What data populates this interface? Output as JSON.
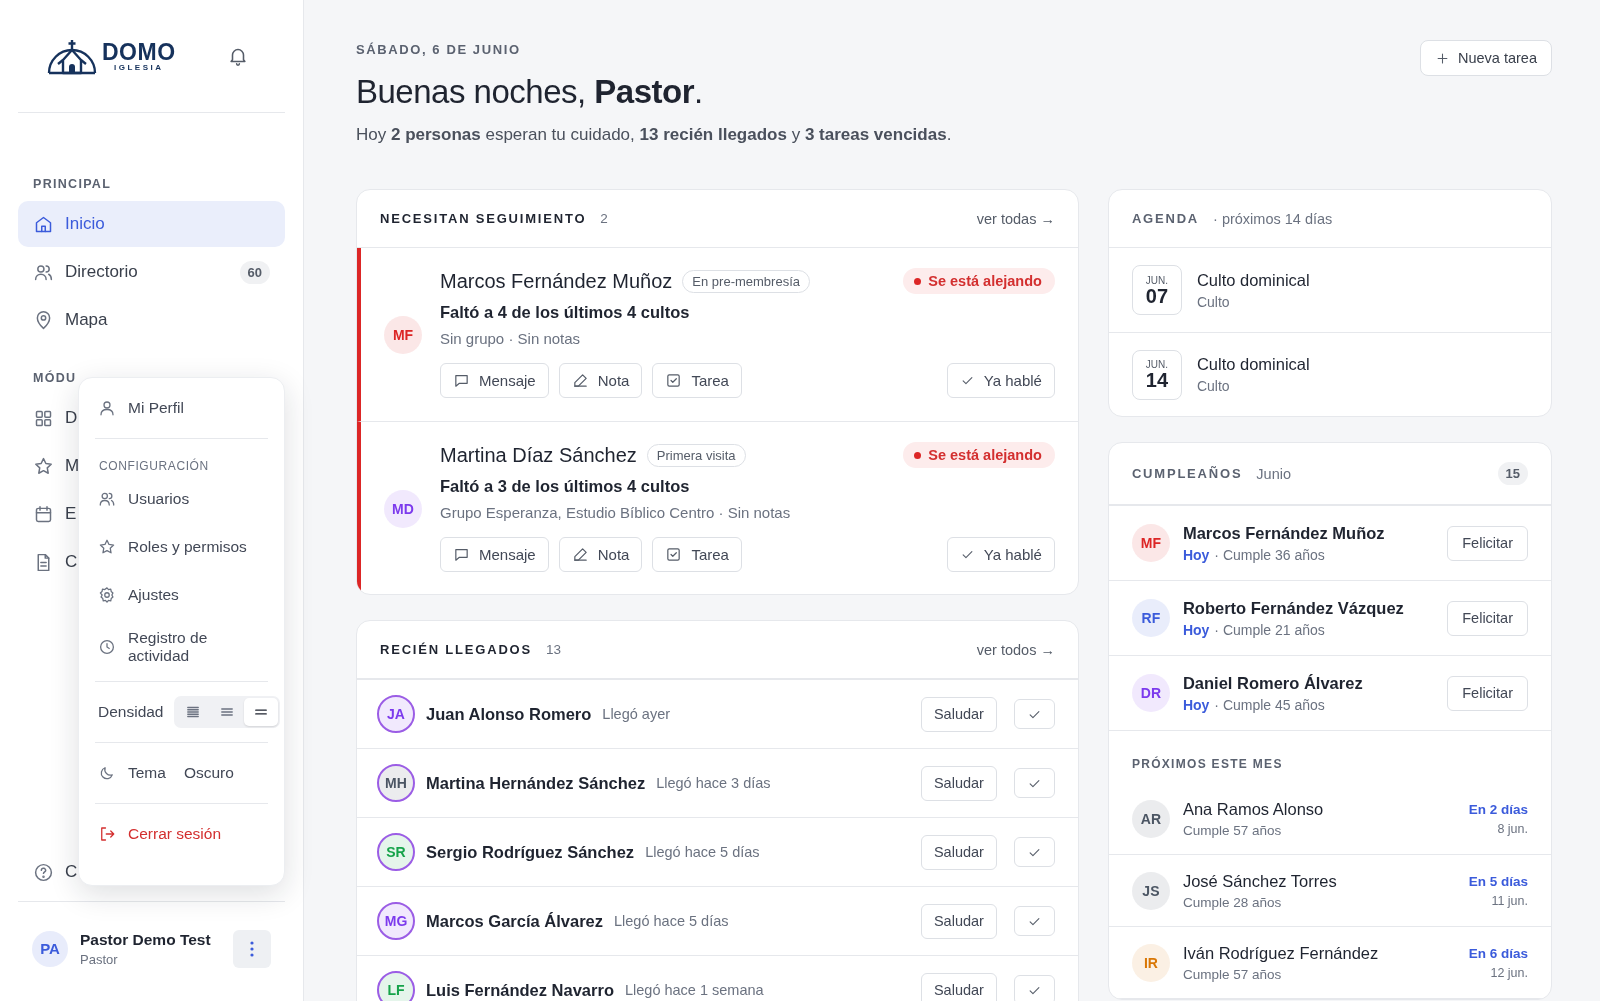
{
  "sidebar": {
    "logo": {
      "name": "DOMO",
      "subtitle": "IGLESIA"
    },
    "sections": [
      {
        "title": "PRINCIPAL",
        "items": [
          {
            "label": "Inicio",
            "selected": true
          },
          {
            "label": "Directorio",
            "count": "60",
            "selected": false
          },
          {
            "label": "Mapa",
            "selected": false
          }
        ]
      },
      {
        "title": "MÓDU",
        "items": [
          {
            "label": "D",
            "selected": false
          },
          {
            "label": "M",
            "selected": false
          },
          {
            "label": "E",
            "selected": false
          },
          {
            "label": "C",
            "selected": false
          }
        ]
      }
    ],
    "help_item": {
      "label": "C"
    },
    "user": {
      "initials": "PA",
      "name": "Pastor Demo Test",
      "role": "Pastor"
    }
  },
  "user_menu": {
    "profile": {
      "label": "Mi Perfil"
    },
    "config_title": "CONFIGURACIÓN",
    "config_items": [
      {
        "label": "Usuarios"
      },
      {
        "label": "Roles y permisos"
      },
      {
        "label": "Ajustes"
      },
      {
        "label": "Registro de actividad"
      }
    ],
    "density": {
      "label": "Densidad",
      "options": [
        {
          "kind": "compact",
          "selected": false
        },
        {
          "kind": "regular",
          "selected": false
        },
        {
          "kind": "spacious",
          "selected": true
        }
      ]
    },
    "theme": {
      "label": "Tema",
      "value": "Oscuro"
    },
    "logout": {
      "label": "Cerrar sesión"
    }
  },
  "header": {
    "date": "SÁBADO, 6 DE JUNIO",
    "greeting": "Buenas noches, **Pastor**.",
    "summary": "Hoy **2 personas** esperan tu cuidado, **13 recién llegados** y **3 tareas vencidas**.",
    "new_task_button": "Nueva tarea"
  },
  "follow_up": {
    "title": "NECESITAN SEGUIMIENTO",
    "count": "2",
    "link": "ver todas →",
    "people": [
      {
        "initials": "MF",
        "color": "#dc2626",
        "name": "Marcos Fernández Muñoz",
        "tag": "En pre-membresía",
        "status": "Se está alejando",
        "reason": "Faltó a 4 de los últimos 4 cultos",
        "details": "Sin grupo · Sin notas",
        "actions": [
          "Mensaje",
          "Nota",
          "Tarea"
        ],
        "done_button": "Ya hablé"
      },
      {
        "initials": "MD",
        "color": "#7c3aed",
        "name": "Martina Díaz Sánchez",
        "tag": "Primera visita",
        "status": "Se está alejando",
        "reason": "Faltó a 3 de los últimos 4 cultos",
        "details": "Grupo Esperanza, Estudio Bíblico Centro · Sin notas",
        "actions": [
          "Mensaje",
          "Nota",
          "Tarea"
        ],
        "done_button": "Ya hablé"
      }
    ]
  },
  "newcomers": {
    "title": "RECIÉN LLEGADOS",
    "count": "13",
    "link": "ver todos →",
    "people": [
      {
        "initials": "JA",
        "color": "#7c3aed",
        "name": "Juan Alonso Romero",
        "arrived": "Llegó ayer",
        "greet_button": "Saludar"
      },
      {
        "initials": "MH",
        "color": "#4b5563",
        "name": "Martina Hernández Sánchez",
        "arrived": "Llegó hace 3 días",
        "greet_button": "Saludar"
      },
      {
        "initials": "SR",
        "color": "#16a34a",
        "name": "Sergio Rodríguez Sánchez",
        "arrived": "Llegó hace 5 días",
        "greet_button": "Saludar"
      },
      {
        "initials": "MG",
        "color": "#7c3aed",
        "name": "Marcos García Álvarez",
        "arrived": "Llegó hace 5 días",
        "greet_button": "Saludar"
      },
      {
        "initials": "LF",
        "color": "#16a34a",
        "name": "Luis Fernández Navarro",
        "arrived": "Llegó hace 1 semana",
        "greet_button": "Saludar"
      }
    ]
  },
  "agenda": {
    "title": "AGENDA",
    "subtitle": "· próximos 14 días",
    "events": [
      {
        "month": "JUN.",
        "day": "07",
        "title": "Culto dominical",
        "type": "Culto"
      },
      {
        "month": "JUN.",
        "day": "14",
        "title": "Culto dominical",
        "type": "Culto"
      }
    ]
  },
  "birthdays": {
    "title": "CUMPLEAÑOS",
    "month": "Junio",
    "count": "15",
    "today": [
      {
        "initials": "MF",
        "color": "#dc2626",
        "name": "Marcos Fernández Muñoz",
        "when": "Hoy",
        "age": "· Cumple 36 años",
        "button": "Felicitar"
      },
      {
        "initials": "RF",
        "color": "#3b5bdb",
        "name": "Roberto Fernández Vázquez",
        "when": "Hoy",
        "age": "· Cumple 21 años",
        "button": "Felicitar"
      },
      {
        "initials": "DR",
        "color": "#7c3aed",
        "name": "Daniel Romero Álvarez",
        "when": "Hoy",
        "age": "· Cumple 45 años",
        "button": "Felicitar"
      }
    ],
    "upcoming_title": "PRÓXIMOS ESTE MES",
    "upcoming": [
      {
        "initials": "AR",
        "color": "#4b5563",
        "name": "Ana Ramos Alonso",
        "age": "Cumple 57 años",
        "in": "En 2 días",
        "date": "8 jun."
      },
      {
        "initials": "JS",
        "color": "#4b5563",
        "name": "José Sánchez Torres",
        "age": "Cumple 28 años",
        "in": "En 5 días",
        "date": "11 jun."
      },
      {
        "initials": "IR",
        "color": "#d97706",
        "name": "Iván Rodríguez Fernández",
        "age": "Cumple 57 años",
        "in": "En 6 días",
        "date": "12 jun."
      }
    ]
  }
}
